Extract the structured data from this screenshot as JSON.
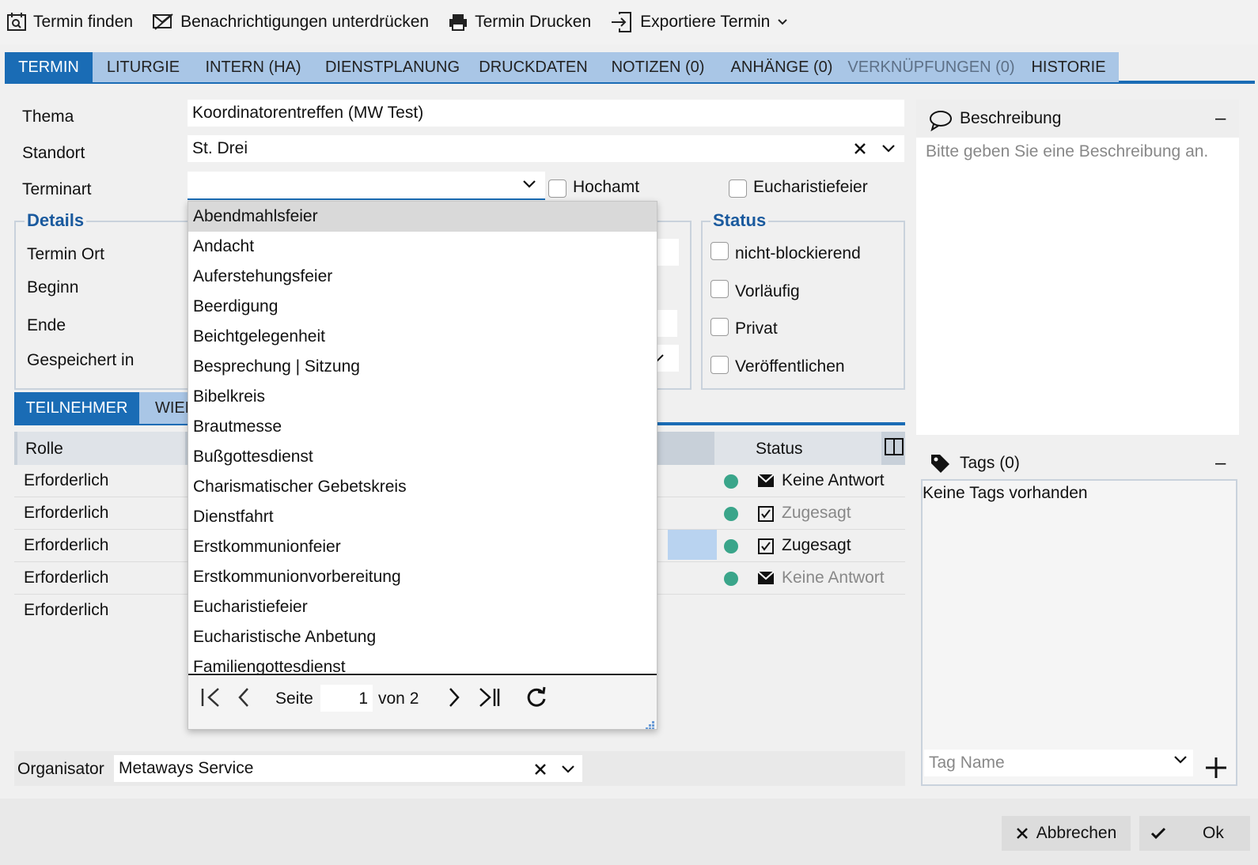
{
  "toolbar": {
    "find": "Termin finden",
    "suppress": "Benachrichtigungen unterdrücken",
    "print": "Termin Drucken",
    "export": "Exportiere Termin"
  },
  "tabs": [
    "TERMIN",
    "LITURGIE",
    "INTERN (HA)",
    "DIENSTPLANUNG",
    "DRUCKDATEN",
    "NOTIZEN (0)",
    "ANHÄNGE (0)",
    "VERKNÜPFUNGEN (0)",
    "HISTORIE"
  ],
  "form": {
    "thema_label": "Thema",
    "thema_value": "Koordinatorentreffen (MW Test)",
    "standort_label": "Standort",
    "standort_value": "St. Drei",
    "terminart_label": "Terminart",
    "terminart_value": "",
    "hochamt": "Hochamt",
    "eucharistiefeier": "Eucharistiefeier"
  },
  "details": {
    "title": "Details",
    "termin_ort": "Termin Ort",
    "beginn": "Beginn",
    "ende": "Ende",
    "gespeichert_in": "Gespeichert in"
  },
  "status_box": {
    "title": "Status",
    "items": [
      "nicht-blockierend",
      "Vorläufig",
      "Privat",
      "Veröffentlichen"
    ]
  },
  "sub_tabs": [
    "TEILNEHMER",
    "WIED"
  ],
  "grid": {
    "col_rolle": "Rolle",
    "col_status": "Status",
    "rows": [
      {
        "rolle": "Erforderlich",
        "status": "Keine Antwort",
        "icon": "envelope-icon"
      },
      {
        "rolle": "Erforderlich",
        "status": "Zugesagt",
        "icon": "check-box-icon"
      },
      {
        "rolle": "Erforderlich",
        "status": "Zugesagt",
        "icon": "check-box-icon"
      },
      {
        "rolle": "Erforderlich",
        "status": "Keine Antwort",
        "icon": "envelope-icon"
      },
      {
        "rolle": "Erforderlich",
        "status": "",
        "icon": ""
      }
    ]
  },
  "dropdown": {
    "items": [
      "Abendmahlsfeier",
      "Andacht",
      "Auferstehungsfeier",
      "Beerdigung",
      "Beichtgelegenheit",
      "Besprechung | Sitzung",
      "Bibelkreis",
      "Brautmesse",
      "Bußgottesdienst",
      "Charismatischer Gebetskreis",
      "Dienstfahrt",
      "Erstkommunionfeier",
      "Erstkommunionvorbereitung",
      "Eucharistiefeier",
      "Eucharistische Anbetung",
      "Familiengottesdienst"
    ],
    "pager": {
      "seite": "Seite",
      "page": "1",
      "von": "von 2"
    }
  },
  "organisator": {
    "label": "Organisator",
    "value": "Metaways Service"
  },
  "beschreibung": {
    "title": "Beschreibung",
    "placeholder": "Bitte geben Sie eine Beschreibung an."
  },
  "tags": {
    "title": "Tags (0)",
    "empty": "Keine Tags vorhanden",
    "placeholder": "Tag Name"
  },
  "footer": {
    "cancel": "Abbrechen",
    "ok": "Ok"
  },
  "colors": {
    "accent": "#1a6cb5",
    "tab_inactive": "#a9c6e6",
    "status_dot": "#3aa58a",
    "title_blue": "#1a5a9e"
  }
}
